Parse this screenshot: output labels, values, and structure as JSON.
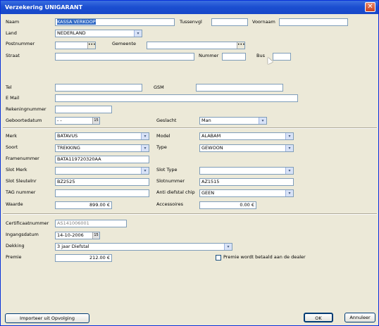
{
  "window": {
    "title": "Verzekering UNIGARANT",
    "close": "✕"
  },
  "person": {
    "naam_label": "Naam",
    "naam_value": "KASSA VERKOOP",
    "tussenvgl_label": "Tussenvgl",
    "tussenvgl_value": "",
    "voornaam_label": "Voornaam",
    "voornaam_value": "",
    "land_label": "Land",
    "land_value": "NEDERLAND",
    "postnummer_label": "Postnummer",
    "postnummer_value": "",
    "gemeente_label": "Gemeente",
    "gemeente_value": "",
    "straat_label": "Straat",
    "straat_value": "",
    "nummer_label": "Nummer",
    "nummer_value": "",
    "bus_label": "Bus",
    "bus_value": "",
    "tel_label": "Tel",
    "tel_value": "",
    "gsm_label": "GSM",
    "gsm_value": "",
    "email_label": "E Mail",
    "email_value": "",
    "rekeningnummer_label": "Rekeningnummer",
    "rekeningnummer_value": "",
    "geboortedatum_label": "Geboortedatum",
    "geboortedatum_value": "- -",
    "geslacht_label": "Geslacht",
    "geslacht_value": "Man"
  },
  "bike": {
    "merk_label": "Merk",
    "merk_value": "BATAVUS",
    "model_label": "Model",
    "model_value": "ALABAM",
    "soort_label": "Soort",
    "soort_value": "TREKKING",
    "type_label": "Type",
    "type_value": "GEWOON",
    "framenummer_label": "Framenummer",
    "framenummer_value": "BATA119720320AA",
    "slotmerk_label": "Slot Merk",
    "slotmerk_value": "",
    "slottype_label": "Slot Type",
    "slottype_value": "",
    "slotsleutel_label": "Slot Sleutelnr",
    "slotsleutel_value": "BZ2525",
    "slotnummer_label": "Slotnummer",
    "slotnummer_value": "AZ1515",
    "tag_label": "TAG nummer",
    "tag_value": "",
    "antidiefstal_label": "Anti diefstal chip",
    "antidiefstal_value": "GEEN",
    "waarde_label": "Waarde",
    "waarde_value": "899.00 €",
    "accessoires_label": "Accessoires",
    "accessoires_value": "0.00 €"
  },
  "policy": {
    "certificaat_label": "Certificaatnummer",
    "certificaat_value": "AS141006001",
    "ingangsdatum_label": "Ingangsdatum",
    "ingangsdatum_value": "14-10-2006",
    "dekking_label": "Dekking",
    "dekking_value": "3 jaar Diefstal",
    "premie_label": "Premie",
    "premie_value": "212.00 €",
    "premie_dealer_label": "Premie wordt betaald aan de dealer",
    "premie_dealer_checked": false
  },
  "buttons": {
    "importeer": "Importeer uit Opvolging",
    "ok": "OK",
    "annuleer": "Annuleer"
  },
  "icons": {
    "dropdown": "▾",
    "lookup": "•••",
    "calendar": "15"
  }
}
